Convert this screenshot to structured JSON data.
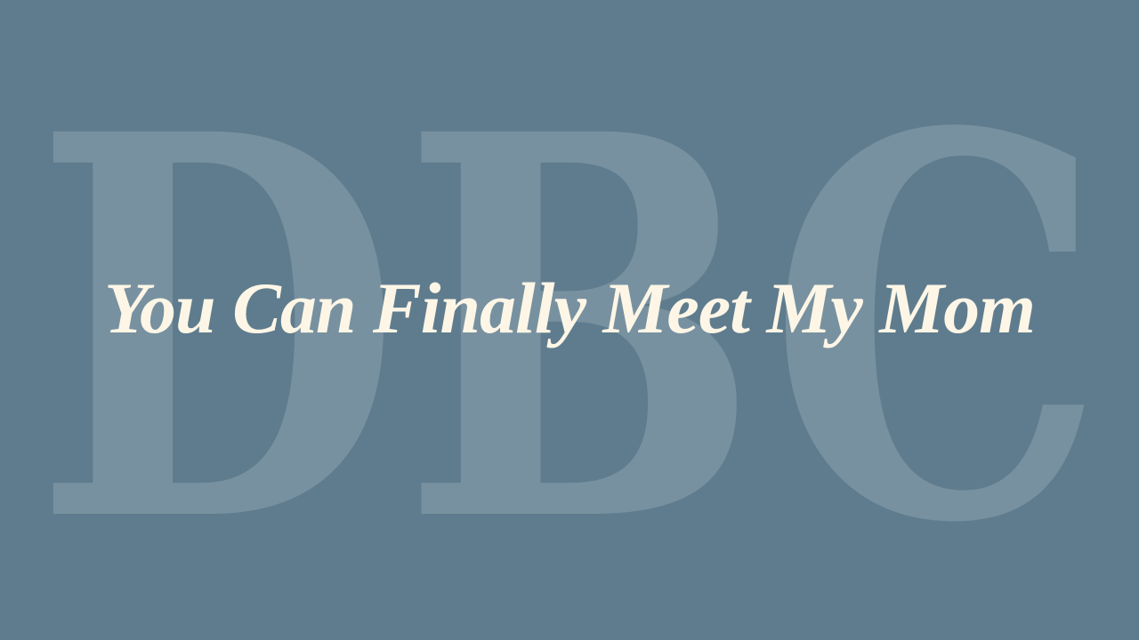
{
  "watermark": {
    "text": "DBC"
  },
  "title": {
    "text": "You Can Finally Meet My Mom"
  },
  "colors": {
    "background": "#5f7c8e",
    "title": "#fdf6e6",
    "watermark": "#ffffff"
  }
}
